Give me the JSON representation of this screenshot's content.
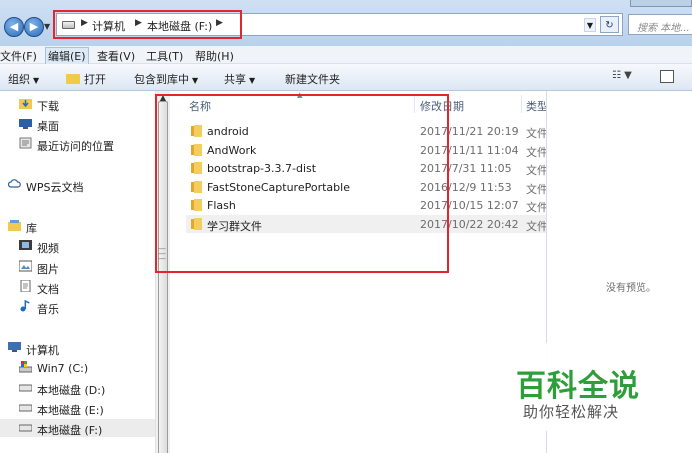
{
  "address_bar": {
    "breadcrumbs": [
      "计算机",
      "本地磁盘 (F:)"
    ],
    "search_placeholder": "搜索 本地..."
  },
  "menu": [
    "文件(F)",
    "编辑(E)",
    "查看(V)",
    "工具(T)",
    "帮助(H)"
  ],
  "toolbar": {
    "organize": "组织",
    "open": "打开",
    "include_in_library": "包含到库中",
    "share": "共享",
    "new_folder": "新建文件夹"
  },
  "nav": {
    "items": [
      {
        "label": "下载",
        "icon": "download-folder-icon"
      },
      {
        "label": "桌面",
        "icon": "desktop-icon"
      },
      {
        "label": "最近访问的位置",
        "icon": "recent-places-icon"
      },
      {
        "label": "WPS云文档",
        "icon": "cloud-icon"
      },
      {
        "label": "库",
        "icon": "library-icon"
      },
      {
        "label": "视频",
        "icon": "video-icon"
      },
      {
        "label": "图片",
        "icon": "picture-icon"
      },
      {
        "label": "文档",
        "icon": "document-icon"
      },
      {
        "label": "音乐",
        "icon": "music-icon"
      },
      {
        "label": "计算机",
        "icon": "computer-icon"
      },
      {
        "label": "Win7 (C:)",
        "icon": "system-drive-icon"
      },
      {
        "label": "本地磁盘 (D:)",
        "icon": "drive-icon"
      },
      {
        "label": "本地磁盘 (E:)",
        "icon": "drive-icon"
      },
      {
        "label": "本地磁盘 (F:)",
        "icon": "drive-icon"
      }
    ]
  },
  "columns": {
    "name": "名称",
    "date": "修改日期",
    "type": "类型"
  },
  "files": [
    {
      "name": "android",
      "date": "2017/11/21 20:19",
      "type": "文件夹"
    },
    {
      "name": "AndWork",
      "date": "2017/11/11 11:04",
      "type": "文件夹"
    },
    {
      "name": "bootstrap-3.3.7-dist",
      "date": "2017/7/31 11:05",
      "type": "文件夹"
    },
    {
      "name": "FastStoneCapturePortable",
      "date": "2016/12/9 11:53",
      "type": "文件夹"
    },
    {
      "name": "Flash",
      "date": "2017/10/15 12:07",
      "type": "文件夹"
    },
    {
      "name": "学习群文件",
      "date": "2017/10/22 20:42",
      "type": "文件夹"
    }
  ],
  "preview": {
    "empty_message": "没有预览。"
  },
  "watermark": {
    "brand": "百科全说",
    "slogan": "助你轻松解决"
  },
  "colors": {
    "highlight_box": "#e2262d",
    "folder": "#f2c94c",
    "brand_green": "#2d9e3a"
  }
}
